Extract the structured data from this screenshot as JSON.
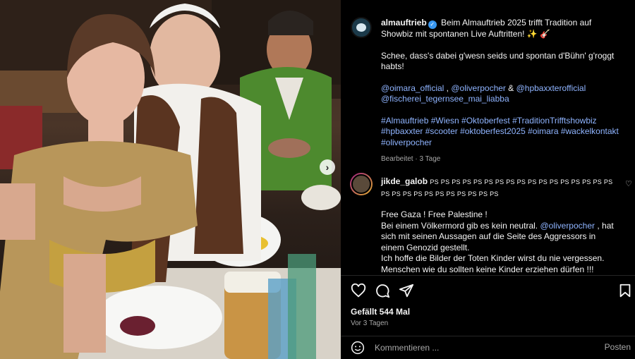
{
  "post": {
    "username": "almauftrieb",
    "caption_title": "Beim Almauftrieb 2025 trifft Tradition auf Showbiz mit spontanen Live Auftritten! ✨ 🎸",
    "caption_body": "Schee, dass's dabei g'wesn seids und spontan d'Bühn' g'roggt habts!",
    "mentions_line1": [
      "@oimara_official",
      "@oliverpocher"
    ],
    "mentions_line1_sep1": " , ",
    "mentions_line1_sep2": " & ",
    "mentions_line1_last": "@hpbaxxterofficial",
    "mentions_line2": "@fischerei_tegernsee_mai_liabba",
    "hashtags": "#Almauftrieb #Wiesn #Oktoberfest #TraditionTrifftshowbiz #hpbaxxter #scooter #oktoberfest2025 #oimara #wackelkontakt #oliverpocher",
    "edited": "Bearbeitet · 3 Tage"
  },
  "comment": {
    "username": "jikde_galob",
    "ps_text": "PS PS PS PS PS PS PS PS PS PS PS PS PS PS PS PS PS PS PS PS PS PS PS PS PS PS PS PS",
    "line1": "Free Gaza ! Free Palestine !",
    "text_before_mention": "Bei einem Völkermord gib es kein neutral. ",
    "mention": "@oliverpocher",
    "text_after_mention": " , hat sich mit seinen Aussagen auf die Seite des Aggressors in einem Genozid gestellt.",
    "line3": "Ich hoffe die Bilder der Toten Kinder wirst du nie vergessen.",
    "line4": "Menschen wie du sollten keine Kinder erziehen dürfen !!!"
  },
  "actions": {
    "likes": "Gefällt 544 Mal",
    "ago": "Vor 3 Tagen"
  },
  "comment_bar": {
    "placeholder": "Kommentieren ...",
    "post_label": "Posten"
  },
  "icons": {
    "like": "heart-icon",
    "comment": "comment-icon",
    "share": "send-icon",
    "save": "bookmark-icon",
    "emoji": "emoji-icon",
    "next": "chevron-right-icon",
    "verified": "verified-badge-icon"
  },
  "colors": {
    "background": "#000000",
    "link": "#8fb4ff",
    "verified": "#3897f0",
    "muted": "#a8a8a8"
  }
}
